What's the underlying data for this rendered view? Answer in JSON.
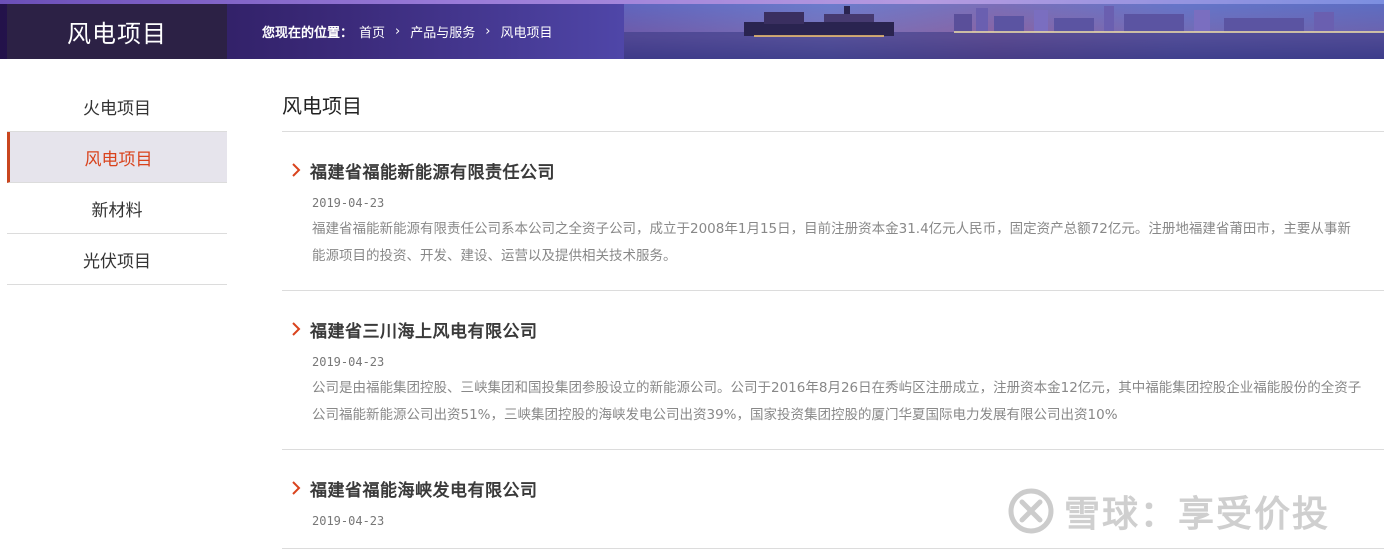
{
  "banner": {
    "page_title": "风电项目",
    "breadcrumb_prefix": "您现在的位置：",
    "breadcrumb": [
      "首页",
      "产品与服务",
      "风电项目"
    ]
  },
  "sidebar": {
    "items": [
      {
        "label": "火电项目",
        "active": false
      },
      {
        "label": "风电项目",
        "active": true
      },
      {
        "label": "新材料",
        "active": false
      },
      {
        "label": "光伏项目",
        "active": false
      }
    ]
  },
  "main": {
    "title": "风电项目",
    "entries": [
      {
        "title": "福建省福能新能源有限责任公司",
        "date": "2019-04-23",
        "desc": "福建省福能新能源有限责任公司系本公司之全资子公司，成立于2008年1月15日，目前注册资本金31.4亿元人民币，固定资产总额72亿元。注册地福建省莆田市，主要从事新能源项目的投资、开发、建设、运营以及提供相关技术服务。"
      },
      {
        "title": "福建省三川海上风电有限公司",
        "date": "2019-04-23",
        "desc": "公司是由福能集团控股、三峡集团和国投集团参股设立的新能源公司。公司于2016年8月26日在秀屿区注册成立，注册资本金12亿元，其中福能集团控股企业福能股份的全资子公司福能新能源公司出资51%，三峡集团控股的海峡发电公司出资39%，国家投资集团控股的厦门华夏国际电力发展有限公司出资10%"
      },
      {
        "title": "福建省福能海峡发电有限公司",
        "date": "2019-04-23",
        "desc": ""
      }
    ]
  },
  "watermark": {
    "text": "雪球：享受价投"
  },
  "colors": {
    "accent": "#d9431d",
    "active_bg": "#e6e4ec",
    "title_box": "#2c2145"
  }
}
